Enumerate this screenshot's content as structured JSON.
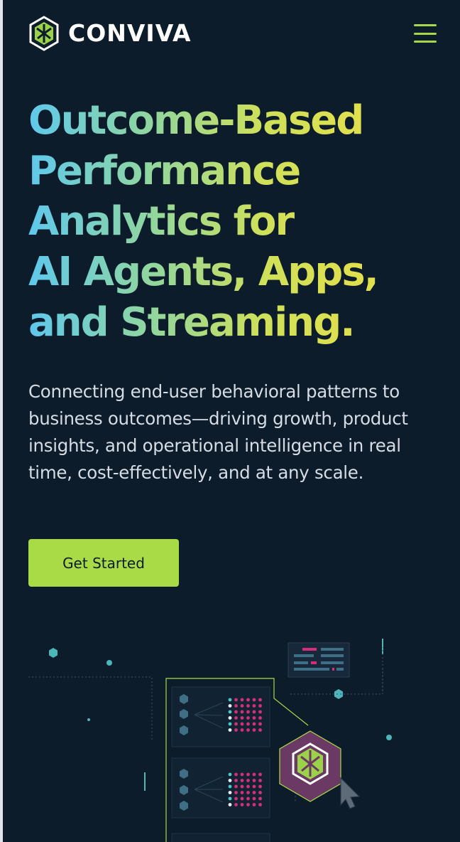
{
  "brand": {
    "name": "CONVIVA"
  },
  "header": {
    "menu_icon": "hamburger-menu-icon"
  },
  "hero": {
    "title_lines": [
      "Outcome-Based",
      "Performance",
      "Analytics for",
      "AI Agents, Apps,",
      "and Streaming."
    ],
    "subtitle": "Connecting end-user behavioral patterns to business outcomes—driving growth, product insights, and operational intelligence in real time, cost-effectively, and at any scale.",
    "cta_label": "Get Started"
  },
  "colors": {
    "background": "#0d1c2b",
    "accent": "#a9db47",
    "gradient_start": "#5fc8ec",
    "gradient_end": "#e2e04c",
    "magenta": "#d62f7a",
    "teal": "#4cc5c9"
  },
  "illustration": {
    "icons": [
      "hexagon-node-icon",
      "data-grid-icon",
      "conviva-badge-icon",
      "cursor-icon",
      "dashboard-panel-icon"
    ]
  }
}
